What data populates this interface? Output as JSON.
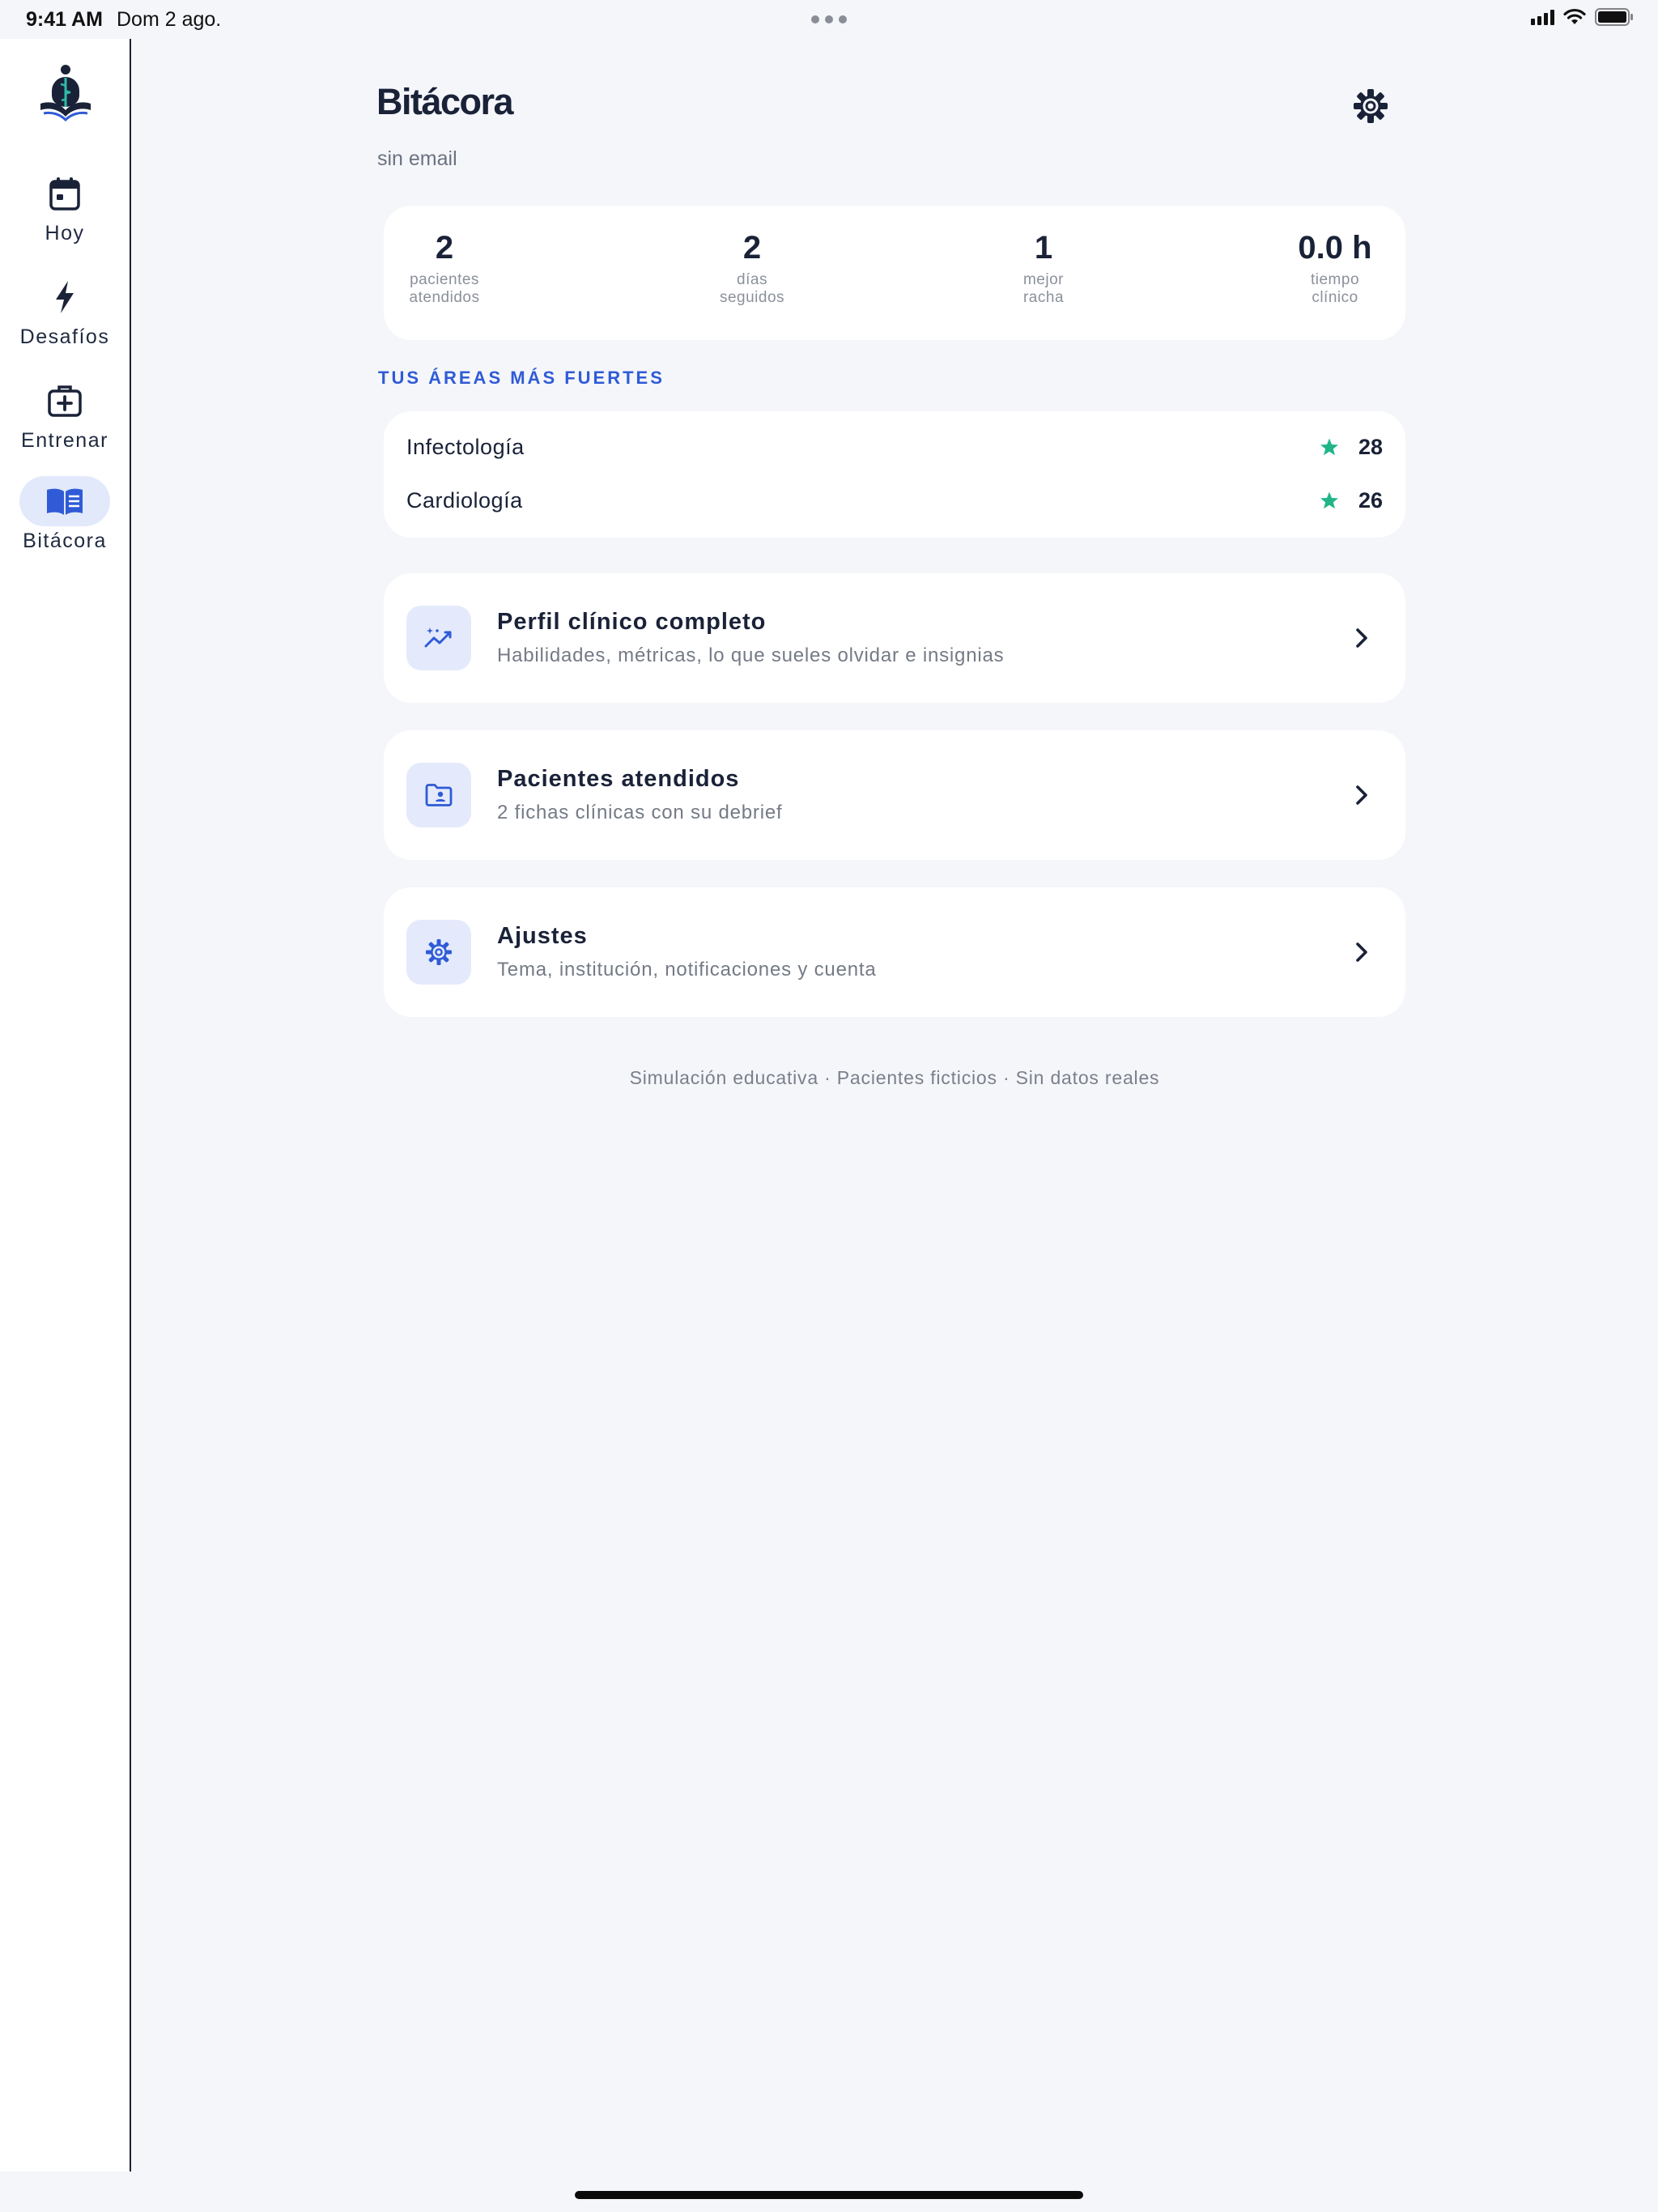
{
  "status_bar": {
    "time": "9:41 AM",
    "date": "Dom 2 ago."
  },
  "sidebar": {
    "items": [
      {
        "label": "Hoy",
        "icon": "calendar-icon"
      },
      {
        "label": "Desafíos",
        "icon": "bolt-icon"
      },
      {
        "label": "Entrenar",
        "icon": "medkit-icon"
      },
      {
        "label": "Bitácora",
        "icon": "book-icon",
        "active": true
      }
    ]
  },
  "header": {
    "title": "Bitácora",
    "subtitle": "sin email",
    "settings_icon": "gear-icon"
  },
  "stats": [
    {
      "value": "2",
      "label_line1": "pacientes",
      "label_line2": "atendidos"
    },
    {
      "value": "2",
      "label_line1": "días",
      "label_line2": "seguidos"
    },
    {
      "value": "1",
      "label_line1": "mejor",
      "label_line2": "racha"
    },
    {
      "value": "0.0 h",
      "label_line1": "tiempo",
      "label_line2": "clínico"
    }
  ],
  "strong_areas": {
    "heading": "TUS ÁREAS MÁS FUERTES",
    "items": [
      {
        "name": "Infectología",
        "score": "28"
      },
      {
        "name": "Cardiología",
        "score": "26"
      }
    ]
  },
  "links": [
    {
      "title": "Perfil clínico completo",
      "subtitle": "Habilidades, métricas, lo que sueles olvidar e insignias",
      "icon": "trend-sparkle-icon"
    },
    {
      "title": "Pacientes atendidos",
      "subtitle": "2 fichas clínicas con su debrief",
      "icon": "patient-folder-icon"
    },
    {
      "title": "Ajustes",
      "subtitle": "Tema, institución, notificaciones y cuenta",
      "icon": "gear-icon"
    }
  ],
  "footer": "Simulación educativa · Pacientes ficticios · Sin datos reales",
  "colors": {
    "accent": "#2f5bd6",
    "star": "#1fb589",
    "text": "#1a2238",
    "background": "#f5f6fa"
  }
}
